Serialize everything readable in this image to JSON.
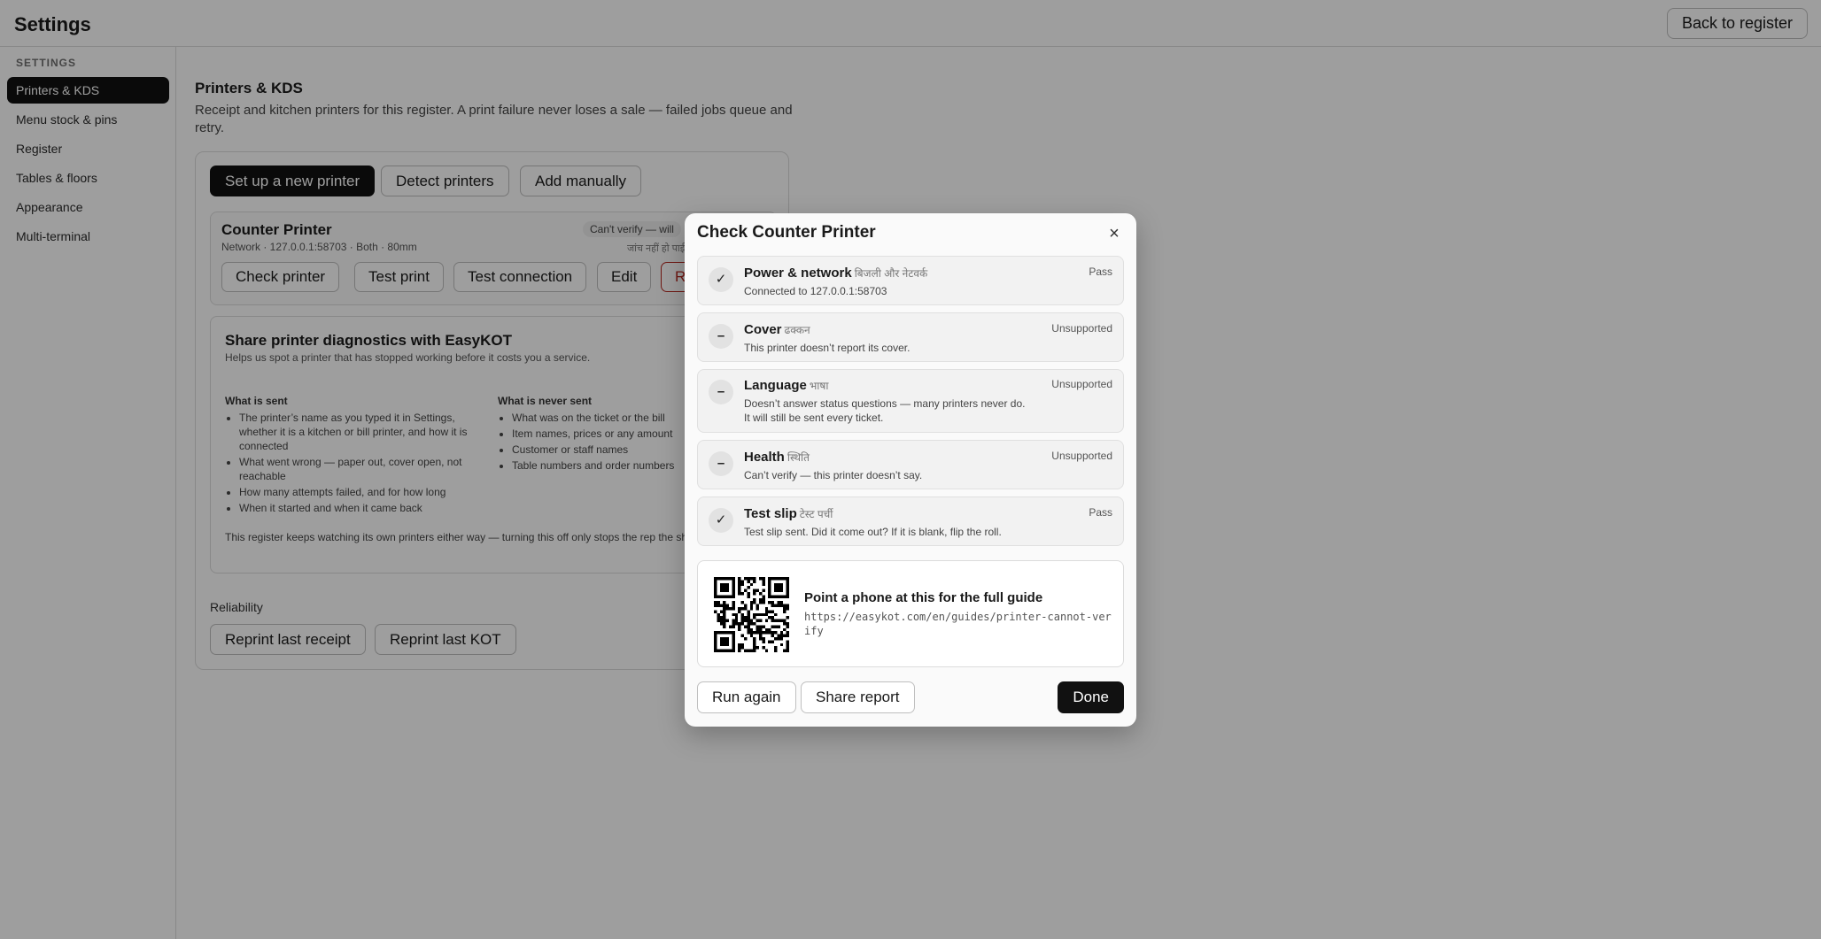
{
  "app": {
    "title": "Settings",
    "back_label": "Back to register"
  },
  "sidebar": {
    "heading": "SETTINGS",
    "items": [
      {
        "label": "Printers & KDS",
        "active": true
      },
      {
        "label": "Menu stock & pins"
      },
      {
        "label": "Register"
      },
      {
        "label": "Tables & floors"
      },
      {
        "label": "Appearance"
      },
      {
        "label": "Multi-terminal"
      }
    ]
  },
  "main": {
    "title": "Printers & KDS",
    "description": "Receipt and kitchen printers for this register. A print failure never loses a sale — failed jobs queue and retry.",
    "actions": {
      "setup": "Set up a new printer",
      "detect": "Detect printers",
      "add": "Add manually"
    },
    "printer": {
      "name": "Counter Printer",
      "meta": "Network · 127.0.0.1:58703 · Both · 80mm",
      "badge": "Can't verify — will",
      "badge_hindi": "जांच नहीं हो पाई",
      "buttons": {
        "check": "Check printer",
        "test_print": "Test print",
        "test_connection": "Test connection",
        "edit": "Edit",
        "remove": "R"
      }
    },
    "share": {
      "title": "Share printer diagnostics with EasyKOT",
      "subtitle": "Helps us spot a printer that has stopped working before it costs you a service.",
      "sent_title": "What is sent",
      "sent": [
        "The printer’s name as you typed it in Settings, whether it is a kitchen or bill printer, and how it is connected",
        "What went wrong — paper out, cover open, not reachable",
        "How many attempts failed, and for how long",
        "When it started and when it came back"
      ],
      "never_title": "What is never sent",
      "never": [
        "What was on the ticket or the bill",
        "Item names, prices or any amount",
        "Customer or staff names",
        "Table numbers and order numbers"
      ],
      "footer": "This register keeps watching its own printers either way — turning this off only stops the rep the shop."
    },
    "reliability": {
      "title": "Reliability",
      "reprint_receipt": "Reprint last receipt",
      "reprint_kot": "Reprint last KOT"
    }
  },
  "modal": {
    "title": "Check Counter Printer",
    "checks": [
      {
        "name": "Power & network",
        "hindi": "बिजली और नेटवर्क",
        "detail": "Connected to 127.0.0.1:58703",
        "status": "Pass",
        "icon": "✓"
      },
      {
        "name": "Cover",
        "hindi": "ढक्कन",
        "detail": "This printer doesn’t report its cover.",
        "status": "Unsupported",
        "icon": "–"
      },
      {
        "name": "Language",
        "hindi": "भाषा",
        "detail": "Doesn’t answer status questions — many printers never do. It will still be sent every ticket.",
        "status": "Unsupported",
        "icon": "–"
      },
      {
        "name": "Health",
        "hindi": "स्थिति",
        "detail": "Can’t verify — this printer doesn’t say.",
        "status": "Unsupported",
        "icon": "–"
      },
      {
        "name": "Test slip",
        "hindi": "टेस्ट पर्ची",
        "detail": "Test slip sent. Did it come out? If it is blank, flip the roll.",
        "status": "Pass",
        "icon": "✓"
      }
    ],
    "guide": {
      "title": "Point a phone at this for the full guide",
      "url": "https://easykot.com/en/guides/printer-cannot-verify"
    },
    "buttons": {
      "run_again": "Run again",
      "share": "Share report",
      "done": "Done"
    }
  }
}
